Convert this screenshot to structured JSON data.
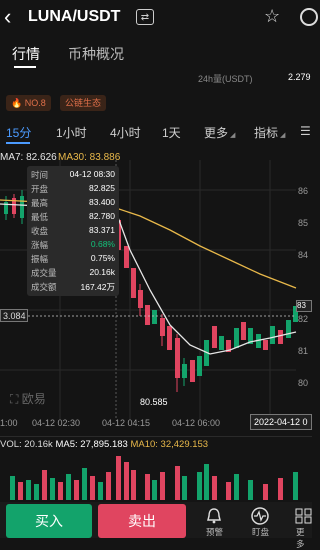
{
  "header": {
    "back_icon": "chevron-left-icon",
    "pair": "LUNA/USDT",
    "swap_icon": "swap-icon",
    "star_icon": "star-icon"
  },
  "tabs": [
    {
      "label": "行情",
      "active": true
    },
    {
      "label": "币种概况",
      "active": false
    }
  ],
  "stats": {
    "vol24_label": "24h量(USDT)",
    "vol24_value": "2.279"
  },
  "badges": [
    {
      "label": "NO.8",
      "icon": "fire-icon"
    },
    {
      "label": "公链生态"
    }
  ],
  "timeframes": [
    {
      "label": "15分",
      "active": true
    },
    {
      "label": "1小时"
    },
    {
      "label": "4小时"
    },
    {
      "label": "1天"
    },
    {
      "label": "更多"
    },
    {
      "label": "指标"
    }
  ],
  "ma": {
    "ma7": "MA7: 82.626",
    "ma30": "MA30: 83.886",
    "ma7_color": "#e6e6e6",
    "ma30_color": "#e8b84a"
  },
  "popup": {
    "rows": [
      {
        "label": "时间",
        "value": "04-12 08:30",
        "color": "#ffffff"
      },
      {
        "label": "开盘",
        "value": "82.825",
        "color": "#ffffff"
      },
      {
        "label": "最高",
        "value": "83.400",
        "color": "#ffffff"
      },
      {
        "label": "最低",
        "value": "82.780",
        "color": "#ffffff"
      },
      {
        "label": "收盘",
        "value": "83.371",
        "color": "#ffffff"
      },
      {
        "label": "涨幅",
        "value": "0.68%",
        "color": "#13c27a"
      },
      {
        "label": "振幅",
        "value": "0.75%",
        "color": "#ffffff"
      },
      {
        "label": "成交量",
        "value": "20.16k",
        "color": "#ffffff"
      },
      {
        "label": "成交额",
        "value": "167.42万",
        "color": "#ffffff"
      }
    ]
  },
  "chart": {
    "left_price_label": "3.084",
    "right_prices": [
      "86",
      "85",
      "84",
      "83",
      "82",
      "81",
      "80"
    ],
    "current_price_tag": "83",
    "low_label": "80.585",
    "logo": "欧易",
    "x_ticks": [
      "1:00",
      "04-12 02:30",
      "04-12 04:15",
      "04-12 06:00"
    ],
    "date_box": "2022-04-12 0",
    "colors": {
      "up": "#13a36b",
      "down": "#e04560",
      "ma7": "#e6e6e6",
      "ma30": "#e8b84a"
    }
  },
  "volume": {
    "vol": "VOL: 20.16k",
    "ma5": "MA5: 27,895.183",
    "ma10": "MA10: 32,429.153"
  },
  "bottom": {
    "buy": "买入",
    "sell": "卖出",
    "items": [
      {
        "label": "预警",
        "icon": "bell-icon"
      },
      {
        "label": "盯盘",
        "icon": "pulse-icon"
      },
      {
        "label": "更多",
        "icon": "grid-icon"
      }
    ]
  }
}
